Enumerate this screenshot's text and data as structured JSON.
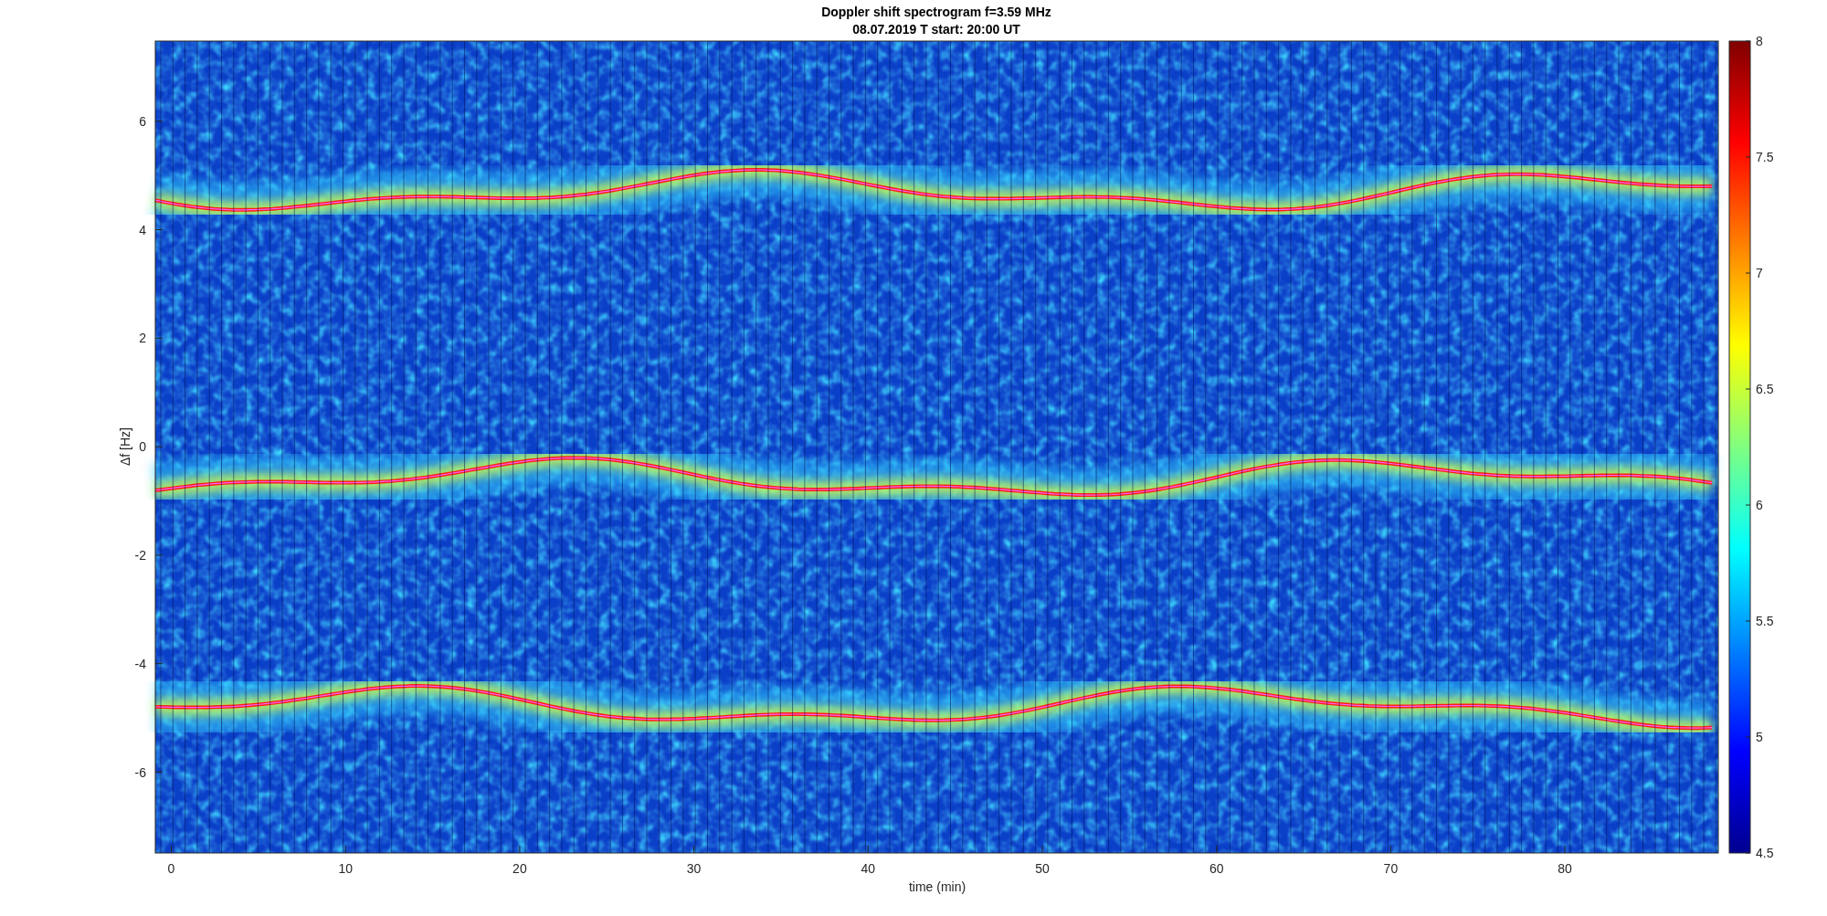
{
  "figure": {
    "title": "Doppler shift spectrogram f=3.59 MHz",
    "subtitle": "08.07.2019    T start: 20:00 UT",
    "xlabel": "time (min)",
    "ylabel": "Δf [Hz]",
    "xticks": [
      "0",
      "10",
      "20",
      "30",
      "40",
      "50",
      "60",
      "70",
      "80"
    ],
    "yticks": [
      "6",
      "4",
      "2",
      "0",
      "-2",
      "-4",
      "-6"
    ],
    "colorbar_ticks": [
      "8",
      "7.5",
      "7",
      "6.5",
      "6",
      "5.5",
      "5",
      "4.5"
    ]
  }
}
